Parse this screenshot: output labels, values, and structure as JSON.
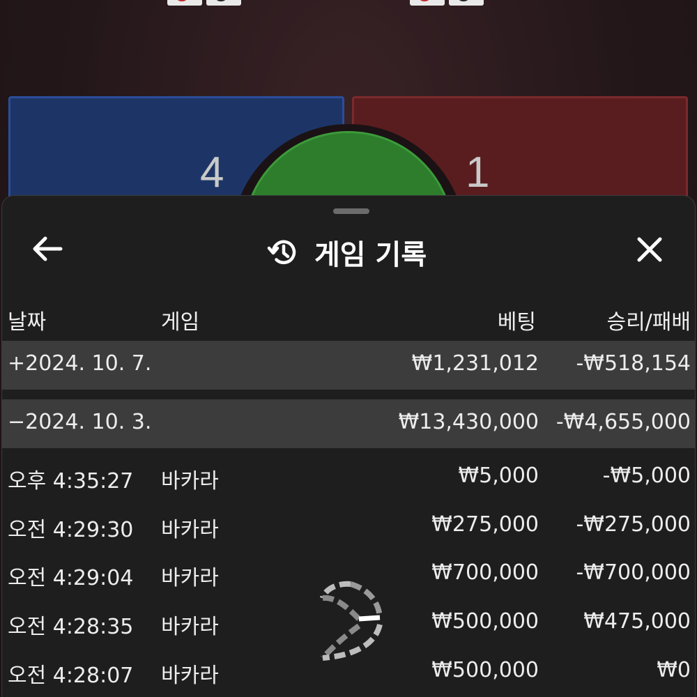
{
  "background": {
    "player_score": "4",
    "banker_score": "1"
  },
  "sheet": {
    "title": "게임 기록",
    "columns": {
      "date": "날짜",
      "game": "게임",
      "bet": "베팅",
      "result": "승리/패배"
    },
    "date_groups": [
      {
        "label": "+2024. 10. 7.",
        "bet": "₩1,231,012",
        "result": "-₩518,154"
      },
      {
        "label": "−2024. 10. 3.",
        "bet": "₩13,430,000",
        "result": "-₩4,655,000"
      }
    ],
    "entries": [
      {
        "time": "오후 4:35:27",
        "game": "바카라",
        "bet": "₩5,000",
        "result": "-₩5,000"
      },
      {
        "time": "오전 4:29:30",
        "game": "바카라",
        "bet": "₩275,000",
        "result": "-₩275,000"
      },
      {
        "time": "오전 4:29:04",
        "game": "바카라",
        "bet": "₩700,000",
        "result": "-₩700,000"
      },
      {
        "time": "오전 4:28:35",
        "game": "바카라",
        "bet": "₩500,000",
        "result": "₩475,000"
      },
      {
        "time": "오전 4:28:07",
        "game": "바카라",
        "bet": "₩500,000",
        "result": "₩0"
      }
    ]
  },
  "icons": {
    "back": "arrow-left-icon",
    "history": "history-icon",
    "close": "close-icon",
    "logo": "brand-logo-icon"
  }
}
